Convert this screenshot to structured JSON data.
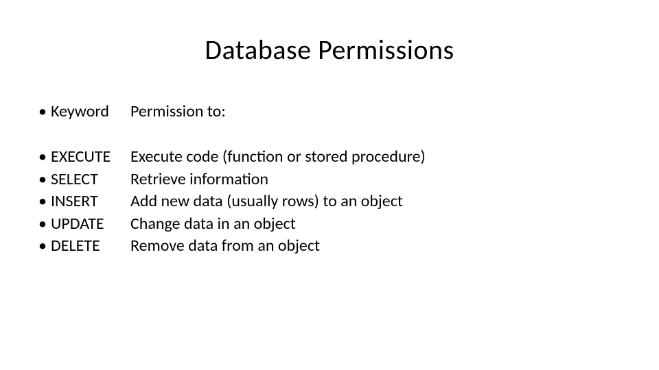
{
  "title": "Database Permissions",
  "header": {
    "keyword": "Keyword",
    "description": "Permission to:"
  },
  "rows": [
    {
      "keyword": "EXECUTE",
      "description": "Execute code (function or stored procedure)"
    },
    {
      "keyword": "SELECT",
      "description": "Retrieve information"
    },
    {
      "keyword": "INSERT",
      "description": "Add new data (usually rows) to an object"
    },
    {
      "keyword": "UPDATE",
      "description": "Change data in an object"
    },
    {
      "keyword": "DELETE",
      "description": "Remove data from an object"
    }
  ]
}
